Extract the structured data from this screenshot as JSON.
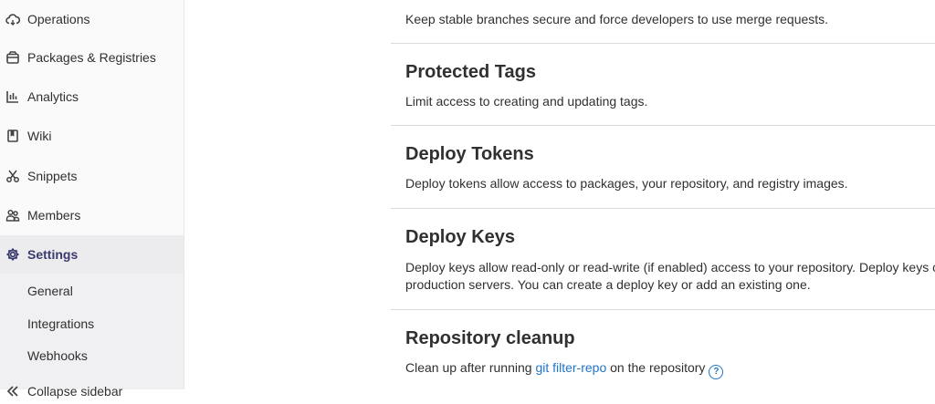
{
  "sidebar": {
    "items": [
      {
        "label": "Operations",
        "icon": "cloud-gear-icon"
      },
      {
        "label": "Packages & Registries",
        "icon": "package-icon"
      },
      {
        "label": "Analytics",
        "icon": "chart-icon"
      },
      {
        "label": "Wiki",
        "icon": "book-icon"
      },
      {
        "label": "Snippets",
        "icon": "scissors-icon"
      },
      {
        "label": "Members",
        "icon": "users-icon"
      },
      {
        "label": "Settings",
        "icon": "gear-icon"
      }
    ],
    "subitems": [
      {
        "label": "General"
      },
      {
        "label": "Integrations"
      },
      {
        "label": "Webhooks"
      }
    ],
    "cut_off_label": "Collapse sidebar"
  },
  "main": {
    "top_desc": "Keep stable branches secure and force developers to use merge requests.",
    "sections": [
      {
        "title": "Protected Tags",
        "desc": "Limit access to creating and updating tags."
      },
      {
        "title": "Deploy Tokens",
        "desc": "Deploy tokens allow access to packages, your repository, and registry images."
      },
      {
        "title": "Deploy Keys",
        "desc_line1": "Deploy keys allow read-only or read-write (if enabled) access to your repository. Deploy keys c",
        "desc_line2": "production servers. You can create a deploy key or add an existing one."
      },
      {
        "title": "Repository cleanup",
        "desc_prefix": "Clean up after running ",
        "desc_link": "git filter-repo",
        "desc_suffix": " on the repository",
        "help_icon": "question-circle-icon",
        "help_glyph": "?"
      }
    ]
  },
  "colors": {
    "link": "#1f75cb",
    "active_bg": "#ececef",
    "sidebar_bg": "#fafafa"
  }
}
